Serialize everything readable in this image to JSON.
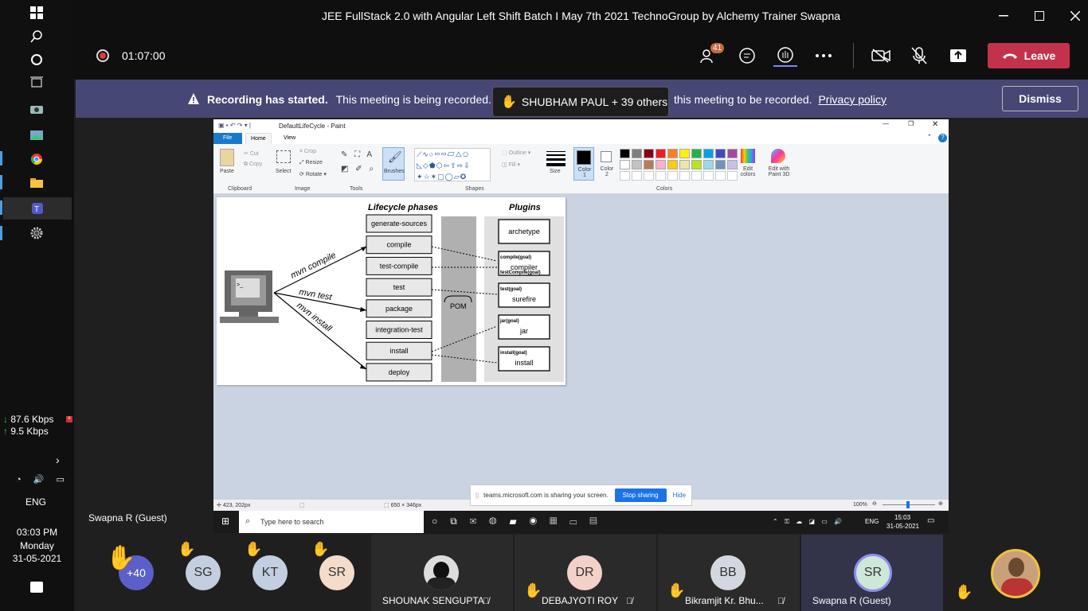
{
  "window": {
    "title": "JEE FullStack 2.0 with Angular Left Shift Batch I May 7th 2021 TechnoGroup by Alchemy Trainer Swapna"
  },
  "controls": {
    "timer": "01:07:00",
    "participants_count": "41",
    "leave_label": "Leave"
  },
  "banner": {
    "bold": "Recording has started.",
    "text": "This meeting is being recorded. E",
    "text2": "this meeting to be recorded.",
    "link": "Privacy policy",
    "dismiss": "Dismiss"
  },
  "raised_hands_tip": "SHUBHAM PAUL + 39 others",
  "sidebar": {
    "down_rate": "87.6 Kbps",
    "up_rate": "9.5 Kbps",
    "lang": "ENG",
    "time": "03:03 PM",
    "day": "Monday",
    "date": "31-05-2021"
  },
  "presenter_name": "Swapna R (Guest)",
  "paint": {
    "title": "DefaultLifeCycle - Paint",
    "tabs": [
      "File",
      "Home",
      "View"
    ],
    "groups": [
      "Clipboard",
      "Image",
      "Tools",
      "Shapes",
      "Colors"
    ],
    "clipboard": {
      "paste": "Paste",
      "cut": "Cut",
      "copy": "Copy"
    },
    "image": {
      "select": "Select",
      "crop": "Crop",
      "resize": "Resize",
      "rotate": "Rotate"
    },
    "brushes": "Brushes",
    "outline": "Outline",
    "fill": "Fill",
    "size": "Size",
    "color1": "Color 1",
    "color2": "Color 2",
    "edit_colors": "Edit colors",
    "edit_3d": "Edit with Paint 3D",
    "palette": [
      "#000000",
      "#7f7f7f",
      "#880015",
      "#ed1c24",
      "#ff7f27",
      "#fff200",
      "#22b14c",
      "#00a2e8",
      "#3f48cc",
      "#a349a4",
      "#ffffff",
      "#c3c3c3",
      "#b97a57",
      "#ffaec9",
      "#ffc90e",
      "#efe4b0",
      "#b5e61d",
      "#99d9ea",
      "#7092be",
      "#c8bfe7"
    ],
    "status_pos": "423, 202px",
    "status_size": "650 × 346px",
    "zoom": "100%"
  },
  "diagram": {
    "phases_title": "Lifecycle phases",
    "plugins_title": "Plugins",
    "phases": [
      "generate-sources",
      "compile",
      "test-compile",
      "test",
      "package",
      "integration-test",
      "install",
      "deploy"
    ],
    "commands": [
      "mvn compile",
      "mvn test",
      "mvn install"
    ],
    "pom": "POM",
    "plugins": [
      {
        "name": "archetype",
        "goals": ""
      },
      {
        "name": "compiler",
        "goals": "compile(goal)",
        "goals2": "testCompile(goal)"
      },
      {
        "name": "surefire",
        "goals": "test(goal)"
      },
      {
        "name": "jar",
        "goals": "jar(goal)"
      },
      {
        "name": "install",
        "goals": "install(goal)"
      }
    ]
  },
  "share_notice": {
    "text": "teams.microsoft.com is sharing your screen.",
    "stop": "Stop sharing",
    "hide": "Hide"
  },
  "win10": {
    "search_placeholder": "Type here to search",
    "lang": "ENG",
    "time": "15:03",
    "date": "31-05-2021"
  },
  "participants": [
    {
      "initials": "+40",
      "color": "#5b5fc7"
    },
    {
      "initials": "SG",
      "color": "#c3cfe0"
    },
    {
      "initials": "KT",
      "color": "#c3cfe0"
    },
    {
      "initials": "SR",
      "color": "#f3dcc9"
    }
  ],
  "video_tiles": [
    {
      "name": "SHOUNAK SENGUPTA"
    },
    {
      "name": "DEBAJYOTI ROY",
      "initials": "DR",
      "color": "#f3d0c8"
    },
    {
      "name": "Bikramjit Kr. Bhu...",
      "initials": "BB",
      "color": "#d3d8e0"
    },
    {
      "name": "Swapna R (Guest)",
      "initials": "SR",
      "color": "#cde8d9"
    }
  ]
}
